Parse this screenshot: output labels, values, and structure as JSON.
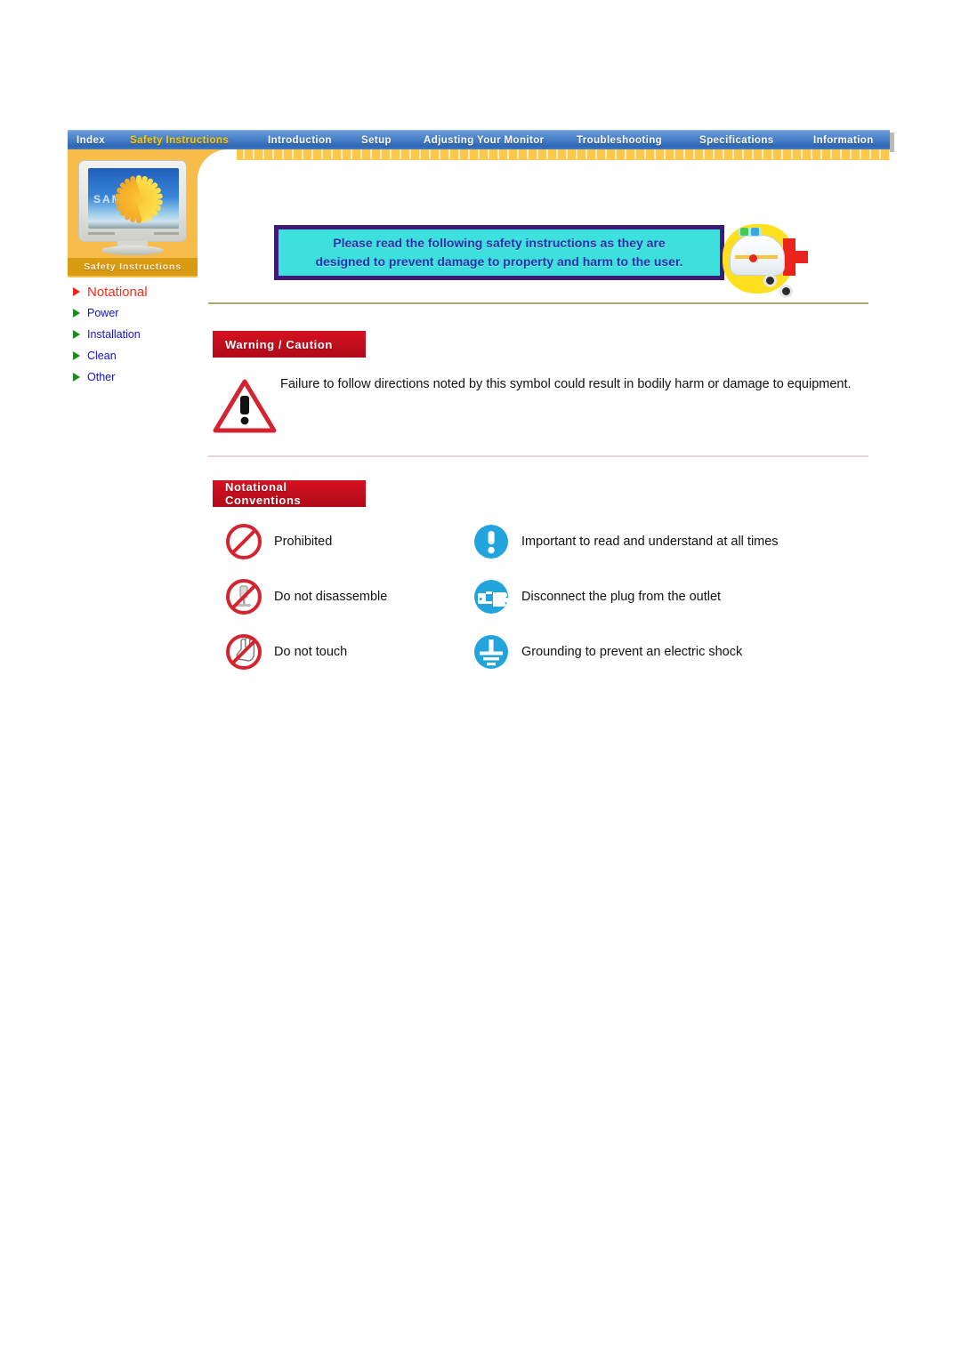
{
  "nav": {
    "items": [
      {
        "label": "Index",
        "active": false
      },
      {
        "label": "Safety Instructions",
        "active": true
      },
      {
        "label": "Introduction",
        "active": false
      },
      {
        "label": "Setup",
        "active": false
      },
      {
        "label": "Adjusting Your Monitor",
        "active": false
      },
      {
        "label": "Troubleshooting",
        "active": false
      },
      {
        "label": "Specifications",
        "active": false
      },
      {
        "label": "Information",
        "active": false
      }
    ]
  },
  "sidebar": {
    "monitor_screen_text": "SAMSUNG",
    "section_label": "Safety Instructions",
    "items": [
      {
        "label": "Notational",
        "active": true
      },
      {
        "label": "Power",
        "active": false
      },
      {
        "label": "Installation",
        "active": false
      },
      {
        "label": "Clean",
        "active": false
      },
      {
        "label": "Other",
        "active": false
      }
    ]
  },
  "banner": {
    "line1": "Please read the following safety instructions as they are",
    "line2": "designed to prevent damage to property and harm to the user."
  },
  "warning": {
    "heading": "Warning / Caution",
    "body": "Failure to follow directions noted by this symbol could result in bodily harm or damage to equipment."
  },
  "conventions": {
    "heading": "Notational Conventions",
    "rows": [
      {
        "left": {
          "icon": "prohibited-icon",
          "label": "Prohibited"
        },
        "right": {
          "icon": "important-exclamation-icon",
          "label": "Important to read and understand at all times"
        }
      },
      {
        "left": {
          "icon": "do-not-disassemble-icon",
          "label": "Do not disassemble"
        },
        "right": {
          "icon": "disconnect-plug-icon",
          "label": "Disconnect the plug from the outlet"
        }
      },
      {
        "left": {
          "icon": "do-not-touch-icon",
          "label": "Do not touch"
        },
        "right": {
          "icon": "grounding-icon",
          "label": "Grounding to prevent an electric shock"
        }
      }
    ]
  },
  "colors": {
    "nav_blue": "#3f78c4",
    "nav_active_text": "#ffcc00",
    "sidebar_orange": "#f7bc4a",
    "sidebar_label_bar": "#d99b12",
    "red_header": "#c00d1c",
    "active_link_red": "#ff2a18",
    "link_blue": "#1212d6",
    "bullet_green": "#1a8a1a",
    "banner_cyan": "#3ee0de",
    "banner_border": "#3b1a78",
    "banner_text": "#2233aa",
    "divider_olive": "#a8a870",
    "divider_pink": "#e9d3d8",
    "prohibit_red": "#d4242f",
    "mandatory_blue": "#22a5dd"
  }
}
